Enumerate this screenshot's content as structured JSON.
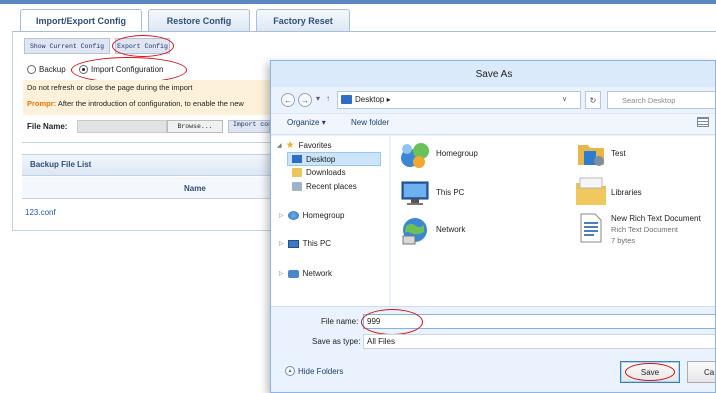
{
  "tabs": [
    {
      "label": "Import/Export Config",
      "active": true
    },
    {
      "label": "Restore Config",
      "active": false
    },
    {
      "label": "Factory Reset",
      "active": false
    }
  ],
  "config_buttons": {
    "show": "Show Current Config",
    "export": "Export Config"
  },
  "mode": {
    "backup_label": "Backup",
    "import_label": "Import Configuration",
    "selected": "Import Configuration"
  },
  "warning": {
    "line1": "Do not refresh or close the page during the import",
    "prompt_key": "Prompr:",
    "prompt_text": "After the introduction of configuration, to enable the new"
  },
  "import_form": {
    "file_label": "File Name:",
    "file_value": "",
    "browse": "Browse...",
    "import": "Import config"
  },
  "backup_list": {
    "title": "Backup File List",
    "column_name": "Name",
    "rows": [
      "123.conf"
    ]
  },
  "dialog": {
    "title": "Save As",
    "address": "Desktop",
    "search_placeholder": "Search Desktop",
    "toolbar": {
      "organize": "Organize",
      "new_folder": "New folder"
    },
    "nav": {
      "favorites": "Favorites",
      "desktop": "Desktop",
      "downloads": "Downloads",
      "recent": "Recent places",
      "homegroup": "Homegroup",
      "thispc": "This PC",
      "network": "Network"
    },
    "items": {
      "homegroup": "Homegroup",
      "thispc": "This PC",
      "network": "Network",
      "test": "Test",
      "libraries": "Libraries",
      "doc_name": "New Rich Text Document",
      "doc_type": "Rich Text Document",
      "doc_size": "7 bytes"
    },
    "file_name_label": "File name:",
    "file_name_value": "999",
    "save_type_label": "Save as type:",
    "save_type_value": "All Files",
    "hide_folders": "Hide Folders",
    "save_button": "Save",
    "cancel_button": "Ca"
  },
  "colors": {
    "accent": "#2f4f7a",
    "highlight": "#d4141b",
    "warning_bg": "#fdf2d9",
    "prompt": "#e8730c",
    "dialog_bg": "#eaf3fd"
  }
}
